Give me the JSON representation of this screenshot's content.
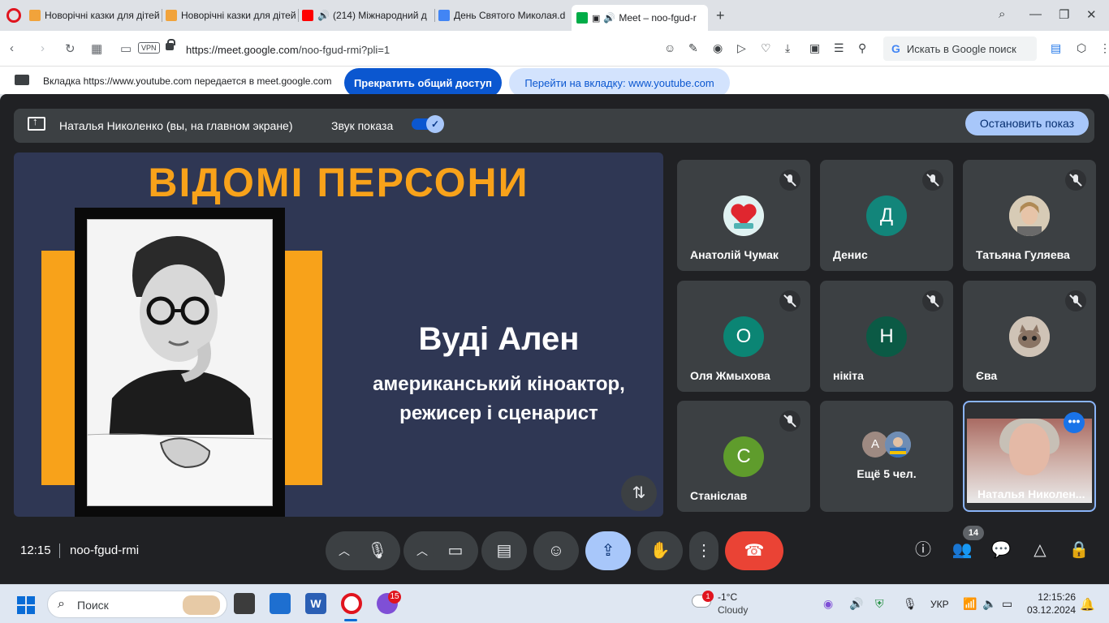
{
  "browser": {
    "tabs": [
      {
        "label": "Новорічні казки для дітей",
        "fav_color": "#f1a33b"
      },
      {
        "label": "Новорічні казки для дітей",
        "fav_color": "#f1a33b"
      },
      {
        "label": "(214) Міжнародний д",
        "fav_color": "#ff0000"
      },
      {
        "label": "День Святого Миколая.d",
        "fav_color": "#4285f4"
      },
      {
        "label": "Meet – noo-fgud-r",
        "fav_color": "#00ac47"
      }
    ],
    "url_host": "https://meet.google.com",
    "url_path": "/noo-fgud-rmi?pli=1",
    "vpn_label": "VPN",
    "search_placeholder": "Искать в Google поиск"
  },
  "sharebar": {
    "message": "Вкладка https://www.youtube.com передается в meet.google.com",
    "stop_label": "Прекратить общий доступ",
    "goto_label": "Перейти на вкладку: www.youtube.com"
  },
  "presenting": {
    "name": "Наталья Николенко (вы, на главном экране)",
    "sound_label": "Звук показа",
    "stop_label": "Остановить показ"
  },
  "slide": {
    "title": "ВІДОМІ ПЕРСОНИ",
    "person": "Вуді Ален",
    "desc_line1": "американський кіноактор,",
    "desc_line2": "режисер і сценарист"
  },
  "participants": [
    {
      "name": "Анатолій Чумак",
      "initial": "",
      "avatar_color": "#e8f4f4",
      "avatar_kind": "image"
    },
    {
      "name": "Денис",
      "initial": "Д",
      "avatar_color": "#12857a"
    },
    {
      "name": "Татьяна Гуляева",
      "initial": "",
      "avatar_color": "#c9b89e",
      "avatar_kind": "image"
    },
    {
      "name": "Оля Жмыхова",
      "initial": "О",
      "avatar_color": "#0b8574"
    },
    {
      "name": "нікіта",
      "initial": "Н",
      "avatar_color": "#0b5a45"
    },
    {
      "name": "Єва",
      "initial": "",
      "avatar_color": "#b9a898",
      "avatar_kind": "image"
    },
    {
      "name": "Станіслав",
      "initial": "С",
      "avatar_color": "#5f9c2c"
    }
  ],
  "more_tile": {
    "label": "Ещё 5 чел.",
    "initial": "А"
  },
  "self_tile": {
    "name": "Наталья Николен..."
  },
  "meeting": {
    "time": "12:15",
    "code": "noo-fgud-rmi",
    "participant_count": "14"
  },
  "taskbar": {
    "search_label": "Поиск",
    "notif_count": "15",
    "weather_badge": "1",
    "temperature": "-1°C",
    "condition": "Cloudy",
    "language": "УКР",
    "time": "12:15:26",
    "date": "03.12.2024"
  }
}
